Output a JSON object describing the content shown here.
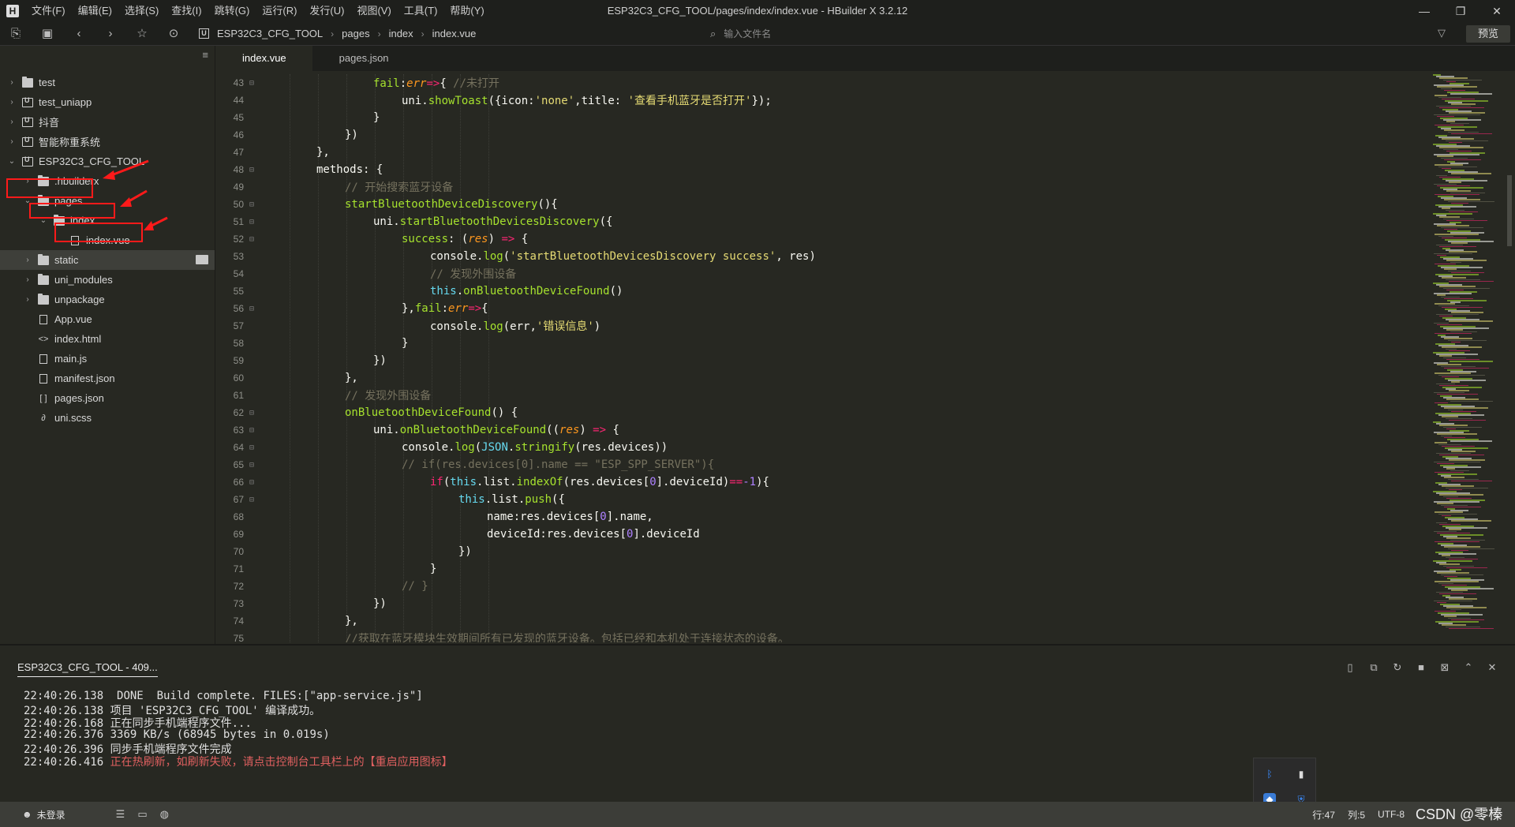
{
  "window": {
    "title": "ESP32C3_CFG_TOOL/pages/index/index.vue - HBuilder X 3.2.12",
    "logo": "H"
  },
  "menu": [
    "文件(F)",
    "编辑(E)",
    "选择(S)",
    "查找(I)",
    "跳转(G)",
    "运行(R)",
    "发行(U)",
    "视图(V)",
    "工具(T)",
    "帮助(Y)"
  ],
  "toolbar": {
    "breadcrumb": [
      "ESP32C3_CFG_TOOL",
      "pages",
      "index",
      "index.vue"
    ],
    "search_placeholder": "输入文件名",
    "preview_label": "预览"
  },
  "sidebar": {
    "items": [
      {
        "label": "test",
        "type": "folder"
      },
      {
        "label": "test_uniapp",
        "type": "project"
      },
      {
        "label": "抖音",
        "type": "project"
      },
      {
        "label": "智能称重系统",
        "type": "project"
      },
      {
        "label": "ESP32C3_CFG_TOOL",
        "type": "project"
      },
      {
        "label": ".hbuilderx",
        "type": "folder"
      },
      {
        "label": "pages",
        "type": "folder"
      },
      {
        "label": "index",
        "type": "folder"
      },
      {
        "label": "index.vue",
        "type": "file"
      },
      {
        "label": "static",
        "type": "folder"
      },
      {
        "label": "uni_modules",
        "type": "folder"
      },
      {
        "label": "unpackage",
        "type": "folder"
      },
      {
        "label": "App.vue",
        "type": "file"
      },
      {
        "label": "index.html",
        "type": "code"
      },
      {
        "label": "main.js",
        "type": "file"
      },
      {
        "label": "manifest.json",
        "type": "file"
      },
      {
        "label": "pages.json",
        "type": "json"
      },
      {
        "label": "uni.scss",
        "type": "style"
      }
    ]
  },
  "tabs": [
    "index.vue",
    "pages.json"
  ],
  "code": {
    "colors": {
      "plain": "#f8f8f2",
      "keyword": "#f92672",
      "func": "#a6e22e",
      "string": "#e6db74",
      "comment": "#75715e",
      "param": "#fd971f",
      "builtin": "#66d9ef",
      "number": "#ae81ff"
    },
    "lines": [
      {
        "n": "43",
        "fold": "⊟",
        "indent": 4,
        "tokens": [
          [
            "func",
            "fail"
          ],
          [
            "plain",
            ":"
          ],
          [
            "param",
            "err"
          ],
          [
            "keyword",
            "=>"
          ],
          [
            "plain",
            "{ "
          ],
          [
            "comment",
            "//未打开"
          ]
        ]
      },
      {
        "n": "44",
        "fold": "",
        "indent": 5,
        "tokens": [
          [
            "plain",
            "uni."
          ],
          [
            "func",
            "showToast"
          ],
          [
            "plain",
            "({icon:"
          ],
          [
            "string",
            "'none'"
          ],
          [
            "plain",
            ",title: "
          ],
          [
            "string",
            "'查看手机蓝牙是否打开'"
          ],
          [
            "plain",
            "});"
          ]
        ]
      },
      {
        "n": "45",
        "fold": "",
        "indent": 4,
        "tokens": [
          [
            "plain",
            "}"
          ]
        ]
      },
      {
        "n": "46",
        "fold": "",
        "indent": 3,
        "tokens": [
          [
            "plain",
            "})"
          ]
        ]
      },
      {
        "n": "47",
        "fold": "",
        "indent": 2,
        "tokens": [
          [
            "plain",
            "},"
          ]
        ]
      },
      {
        "n": "48",
        "fold": "⊟",
        "indent": 2,
        "tokens": [
          [
            "plain",
            "methods: {"
          ]
        ]
      },
      {
        "n": "49",
        "fold": "",
        "indent": 3,
        "tokens": [
          [
            "comment",
            "// 开始搜索蓝牙设备"
          ]
        ]
      },
      {
        "n": "50",
        "fold": "⊟",
        "indent": 3,
        "tokens": [
          [
            "func",
            "startBluetoothDeviceDiscovery"
          ],
          [
            "plain",
            "(){"
          ]
        ]
      },
      {
        "n": "51",
        "fold": "⊟",
        "indent": 4,
        "tokens": [
          [
            "plain",
            "uni."
          ],
          [
            "func",
            "startBluetoothDevicesDiscovery"
          ],
          [
            "plain",
            "({"
          ]
        ]
      },
      {
        "n": "52",
        "fold": "⊟",
        "indent": 5,
        "tokens": [
          [
            "func",
            "success"
          ],
          [
            "plain",
            ": ("
          ],
          [
            "param",
            "res"
          ],
          [
            "plain",
            ") "
          ],
          [
            "keyword",
            "=>"
          ],
          [
            "plain",
            " {"
          ]
        ]
      },
      {
        "n": "53",
        "fold": "",
        "indent": 6,
        "tokens": [
          [
            "plain",
            "console."
          ],
          [
            "func",
            "log"
          ],
          [
            "plain",
            "("
          ],
          [
            "string",
            "'startBluetoothDevicesDiscovery success'"
          ],
          [
            "plain",
            ", res)"
          ]
        ]
      },
      {
        "n": "54",
        "fold": "",
        "indent": 6,
        "tokens": [
          [
            "comment",
            "// 发现外围设备"
          ]
        ]
      },
      {
        "n": "55",
        "fold": "",
        "indent": 6,
        "tokens": [
          [
            "builtin",
            "this"
          ],
          [
            "plain",
            "."
          ],
          [
            "func",
            "onBluetoothDeviceFound"
          ],
          [
            "plain",
            "()"
          ]
        ]
      },
      {
        "n": "56",
        "fold": "⊟",
        "indent": 5,
        "tokens": [
          [
            "plain",
            "},"
          ],
          [
            "func",
            "fail"
          ],
          [
            "plain",
            ":"
          ],
          [
            "param",
            "err"
          ],
          [
            "keyword",
            "=>"
          ],
          [
            "plain",
            "{"
          ]
        ]
      },
      {
        "n": "57",
        "fold": "",
        "indent": 6,
        "tokens": [
          [
            "plain",
            "console."
          ],
          [
            "func",
            "log"
          ],
          [
            "plain",
            "(err,"
          ],
          [
            "string",
            "'错误信息'"
          ],
          [
            "plain",
            ")"
          ]
        ]
      },
      {
        "n": "58",
        "fold": "",
        "indent": 5,
        "tokens": [
          [
            "plain",
            "}"
          ]
        ]
      },
      {
        "n": "59",
        "fold": "",
        "indent": 4,
        "tokens": [
          [
            "plain",
            "})"
          ]
        ]
      },
      {
        "n": "60",
        "fold": "",
        "indent": 3,
        "tokens": [
          [
            "plain",
            "},"
          ]
        ]
      },
      {
        "n": "61",
        "fold": "",
        "indent": 3,
        "tokens": [
          [
            "comment",
            "// 发现外围设备"
          ]
        ]
      },
      {
        "n": "62",
        "fold": "⊟",
        "indent": 3,
        "tokens": [
          [
            "func",
            "onBluetoothDeviceFound"
          ],
          [
            "plain",
            "() {"
          ]
        ]
      },
      {
        "n": "63",
        "fold": "⊟",
        "indent": 4,
        "tokens": [
          [
            "plain",
            "uni."
          ],
          [
            "func",
            "onBluetoothDeviceFound"
          ],
          [
            "plain",
            "(("
          ],
          [
            "param",
            "res"
          ],
          [
            "plain",
            ") "
          ],
          [
            "keyword",
            "=>"
          ],
          [
            "plain",
            " {"
          ]
        ]
      },
      {
        "n": "64",
        "fold": "⊟",
        "indent": 5,
        "tokens": [
          [
            "plain",
            "console."
          ],
          [
            "func",
            "log"
          ],
          [
            "plain",
            "("
          ],
          [
            "builtin",
            "JSON"
          ],
          [
            "plain",
            "."
          ],
          [
            "func",
            "stringify"
          ],
          [
            "plain",
            "(res.devices))"
          ]
        ]
      },
      {
        "n": "65",
        "fold": "⊟",
        "indent": 5,
        "tokens": [
          [
            "comment",
            "// if(res.devices[0].name == \"ESP_SPP_SERVER\"){"
          ]
        ]
      },
      {
        "n": "66",
        "fold": "⊟",
        "indent": 6,
        "tokens": [
          [
            "keyword",
            "if"
          ],
          [
            "plain",
            "("
          ],
          [
            "builtin",
            "this"
          ],
          [
            "plain",
            ".list."
          ],
          [
            "func",
            "indexOf"
          ],
          [
            "plain",
            "(res.devices["
          ],
          [
            "number",
            "0"
          ],
          [
            "plain",
            "].deviceId)"
          ],
          [
            "keyword",
            "=="
          ],
          [
            "number",
            "-1"
          ],
          [
            "plain",
            "){"
          ]
        ]
      },
      {
        "n": "67",
        "fold": "⊟",
        "indent": 7,
        "tokens": [
          [
            "builtin",
            "this"
          ],
          [
            "plain",
            ".list."
          ],
          [
            "func",
            "push"
          ],
          [
            "plain",
            "({"
          ]
        ]
      },
      {
        "n": "68",
        "fold": "",
        "indent": 8,
        "tokens": [
          [
            "plain",
            "name:res.devices["
          ],
          [
            "number",
            "0"
          ],
          [
            "plain",
            "].name,"
          ]
        ]
      },
      {
        "n": "69",
        "fold": "",
        "indent": 8,
        "tokens": [
          [
            "plain",
            "deviceId:res.devices["
          ],
          [
            "number",
            "0"
          ],
          [
            "plain",
            "].deviceId"
          ]
        ]
      },
      {
        "n": "70",
        "fold": "",
        "indent": 7,
        "tokens": [
          [
            "plain",
            "})"
          ]
        ]
      },
      {
        "n": "71",
        "fold": "",
        "indent": 6,
        "tokens": [
          [
            "plain",
            "}"
          ]
        ]
      },
      {
        "n": "72",
        "fold": "",
        "indent": 5,
        "tokens": [
          [
            "comment",
            "// }"
          ]
        ]
      },
      {
        "n": "73",
        "fold": "",
        "indent": 4,
        "tokens": [
          [
            "plain",
            "})"
          ]
        ]
      },
      {
        "n": "74",
        "fold": "",
        "indent": 3,
        "tokens": [
          [
            "plain",
            "},"
          ]
        ]
      },
      {
        "n": "75",
        "fold": "",
        "indent": 3,
        "tokens": [
          [
            "comment",
            "//获取在蓝牙模块生效期间所有已发现的蓝牙设备。包括已经和本机处于连接状态的设备。"
          ]
        ]
      }
    ]
  },
  "console": {
    "tab_label": "ESP32C3_CFG_TOOL - 409...",
    "logs": [
      {
        "time": "22:40:26.138",
        "text": " DONE  Build complete. FILES:[\"app-service.js\"]",
        "warn": false
      },
      {
        "time": "22:40:26.138",
        "text": "项目 'ESP32C3_CFG_TOOL' 编译成功。",
        "warn": false
      },
      {
        "time": "22:40:26.168",
        "text": "正在同步手机端程序文件...",
        "warn": false
      },
      {
        "time": "22:40:26.376",
        "text": "3369 KB/s (68945 bytes in 0.019s)",
        "warn": false
      },
      {
        "time": "22:40:26.396",
        "text": "同步手机端程序文件完成",
        "warn": false
      },
      {
        "time": "22:40:26.416",
        "text": "正在热刷新，如刷新失败，请点击控制台工具栏上的【重启应用图标】",
        "warn": true
      }
    ]
  },
  "statusbar": {
    "login": "未登录",
    "line": "行:47",
    "col": "列:5",
    "encoding": "UTF-8",
    "watermark": "CSDN @零榛"
  }
}
